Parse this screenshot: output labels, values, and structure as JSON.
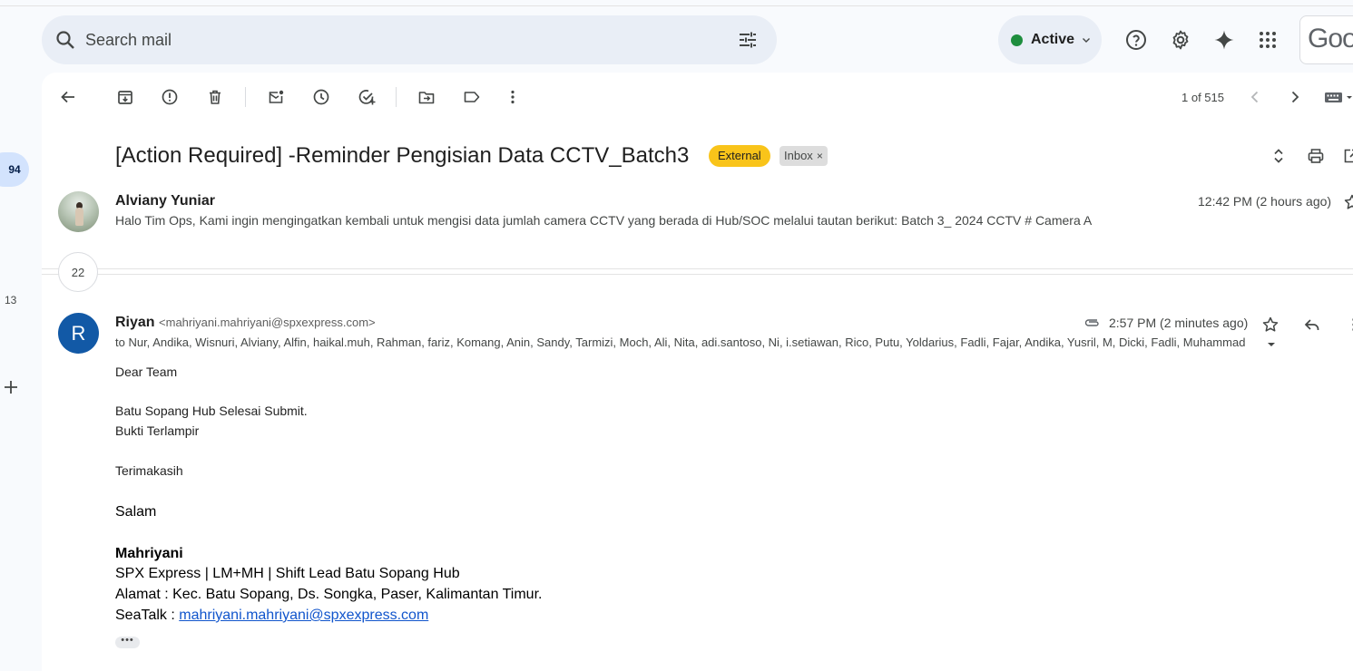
{
  "rail": {
    "badge": "94",
    "count": "13"
  },
  "search": {
    "placeholder": "Search mail"
  },
  "status": {
    "label": "Active",
    "color": "#1e8e3e"
  },
  "brand": {
    "text": "Goo"
  },
  "pager": {
    "text": "1 of 515"
  },
  "thread": {
    "subject": "[Action Required] -Reminder Pengisian Data CCTV_Batch3",
    "labels": {
      "external": "External",
      "inbox": "Inbox",
      "inbox_remove": "×"
    },
    "collapsed_count": "22"
  },
  "message1": {
    "sender": "Alviany Yuniar",
    "snippet": "Halo Tim Ops, Kami ingin mengingatkan kembali untuk mengisi data jumlah camera CCTV yang berada di Hub/SOC melalui tautan berikut: Batch 3_ 2024 CCTV # Camera A",
    "time": "12:42 PM (2 hours ago)"
  },
  "message2": {
    "avatar_letter": "R",
    "sender_name": "Riyan",
    "sender_email": "<mahriyani.mahriyani@spxexpress.com>",
    "recipients": "to Nur, Andika, Wisnuri, Alviany, Alfin, haikal.muh, Rahman, fariz, Komang, Anin, Sandy, Tarmizi, Moch, Ali, Nita, adi.santoso, Ni, i.setiawan, Rico, Putu, Yoldarius, Fadli, Fajar, Andika, Yusril, M, Dicki, Fadli, Muhammad",
    "time": "2:57 PM (2 minutes ago)",
    "body": {
      "greeting": "Dear Team",
      "line1": "Batu Sopang Hub Selesai Submit.",
      "line2": "Bukti Terlampir",
      "thanks": "Terimakasih",
      "salam": "Salam",
      "sig_name": "Mahriyani",
      "sig_role": "SPX Express | LM+MH | Shift Lead Batu Sopang Hub",
      "sig_address": "Alamat : Kec. Batu Sopang, Ds. Songka, Paser, Kalimantan Timur.",
      "sig_seatalk_label": "SeaTalk : ",
      "sig_seatalk_link": "mahriyani.mahriyani@spxexpress.com"
    },
    "trimmed": "•••"
  }
}
